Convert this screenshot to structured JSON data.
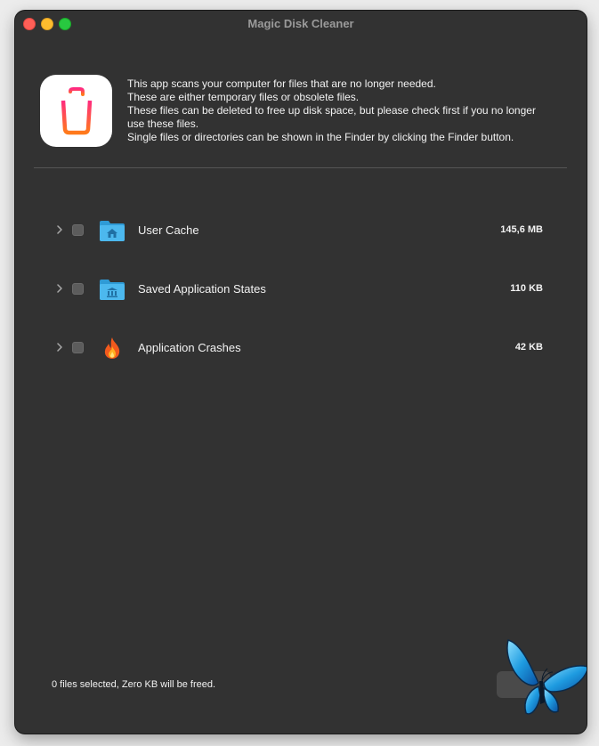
{
  "window": {
    "title": "Magic Disk Cleaner"
  },
  "header": {
    "app_icon": "trash-icon",
    "description_lines": [
      "This app scans your computer for files that are no longer needed.",
      "These are either temporary files or obsolete files.",
      "These files can be deleted to free up disk space, but please check first if you no longer",
      "use these files.",
      "Single files or directories can be shown in the Finder by clicking the Finder button."
    ]
  },
  "categories": [
    {
      "label": "User Cache",
      "size": "145,6 MB",
      "icon": "folder-home-icon",
      "checked": false,
      "expanded": false
    },
    {
      "label": "Saved Application States",
      "size": "110 KB",
      "icon": "folder-app-icon",
      "checked": false,
      "expanded": false
    },
    {
      "label": "Application Crashes",
      "size": "42 KB",
      "icon": "fire-icon",
      "checked": false,
      "expanded": false
    }
  ],
  "footer": {
    "status": "0 files selected, Zero KB will be freed."
  },
  "colors": {
    "window_bg": "#323232",
    "text": "#f2f2f2",
    "folder_blue": "#3fb0e8",
    "trash_gradient_top": "#ff2a80",
    "trash_gradient_bottom": "#ff7a1a"
  }
}
